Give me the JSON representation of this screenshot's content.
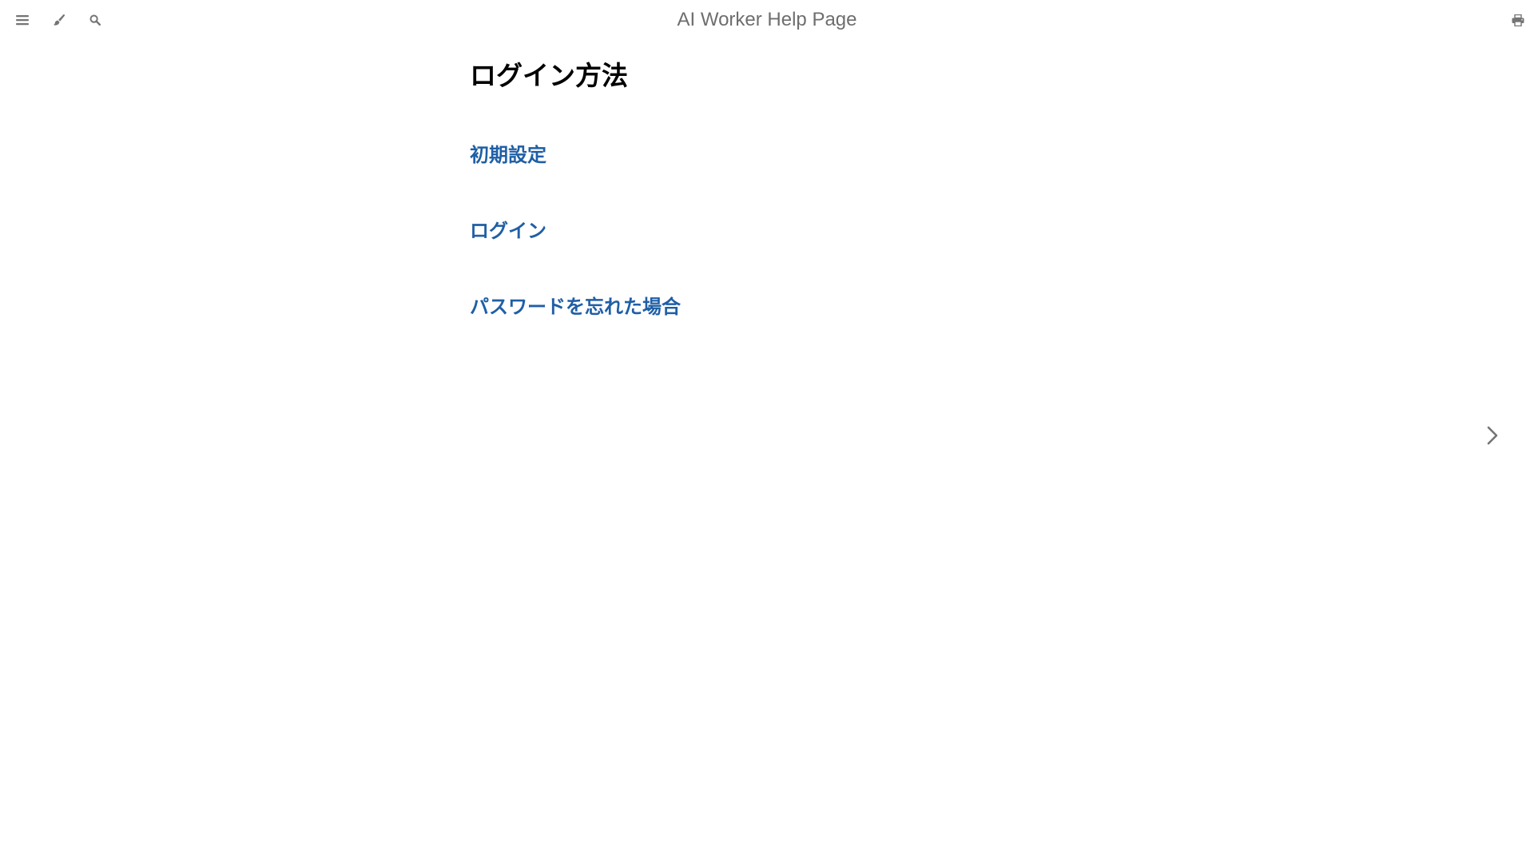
{
  "menu_bar": {
    "title": "AI Worker Help Page",
    "icons": {
      "toggle": "bars-icon",
      "theme": "paintbrush-icon",
      "search": "search-icon",
      "print": "print-icon"
    },
    "icon_color": "#747474"
  },
  "main": {
    "title": "ログイン方法",
    "links": [
      {
        "label": "初期設定"
      },
      {
        "label": "ログイン"
      },
      {
        "label": "パスワードを忘れた場合"
      }
    ],
    "link_color": "#1f5fa6"
  },
  "navigation": {
    "next_icon": "chevron-right-icon"
  }
}
